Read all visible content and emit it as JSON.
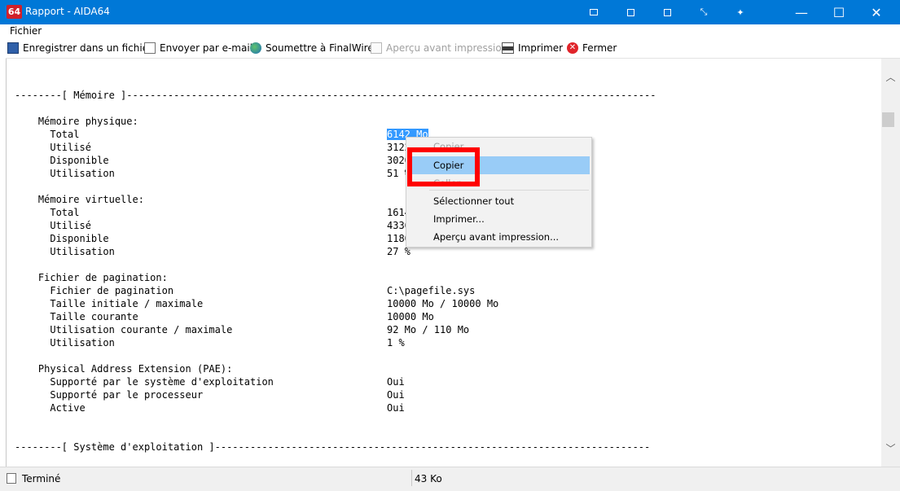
{
  "window": {
    "app_icon": "64",
    "title": "Rapport - AIDA64",
    "minimize": "—",
    "maximize": "☐",
    "close": "✕"
  },
  "menu": {
    "items": [
      "Fichier"
    ]
  },
  "toolbar": {
    "save": "Enregistrer dans un fichier",
    "email": "Envoyer par e-mail",
    "submit": "Soumettre à FinalWire",
    "preview": "Aperçu avant impression",
    "print": "Imprimer",
    "close": "Fermer"
  },
  "report": {
    "memory_header": "--------[ Mémoire ]------------------------------------------------------------------------------------------",
    "physical": {
      "title": "Mémoire physique:",
      "rows": [
        {
          "label": "Total",
          "value": "6142 Mo"
        },
        {
          "label": "Utilisé",
          "value": "3122"
        },
        {
          "label": "Disponible",
          "value": "3020"
        },
        {
          "label": "Utilisation",
          "value": "51 %"
        }
      ]
    },
    "virtual": {
      "title": "Mémoire virtuelle:",
      "rows": [
        {
          "label": "Total",
          "value": "1614"
        },
        {
          "label": "Utilisé",
          "value": "4336"
        },
        {
          "label": "Disponible",
          "value": "1180"
        },
        {
          "label": "Utilisation",
          "value": "27 %"
        }
      ]
    },
    "paging": {
      "title": "Fichier de pagination:",
      "rows": [
        {
          "label": "Fichier de pagination",
          "value": "C:\\pagefile.sys"
        },
        {
          "label": "Taille initiale / maximale",
          "value": "10000 Mo / 10000 Mo"
        },
        {
          "label": "Taille courante",
          "value": "10000 Mo"
        },
        {
          "label": "Utilisation courante / maximale",
          "value": "92 Mo / 110 Mo"
        },
        {
          "label": "Utilisation",
          "value": "1 %"
        }
      ]
    },
    "pae": {
      "title": "Physical Address Extension (PAE):",
      "rows": [
        {
          "label": "Supporté par le système d'exploitation",
          "value": "Oui"
        },
        {
          "label": "Supporté par le processeur",
          "value": "Oui"
        },
        {
          "label": "Active",
          "value": "Oui"
        }
      ]
    },
    "os_header": "--------[ Système d'exploitation ]--------------------------------------------------------------------------"
  },
  "context_menu": {
    "items": [
      {
        "label": "Copier",
        "state": "disabled"
      },
      {
        "label": "Copier",
        "state": "hover"
      },
      {
        "label": "Coller",
        "state": "disabled"
      },
      {
        "label": "Sélectionner tout",
        "state": "normal"
      },
      {
        "label": "Imprimer...",
        "state": "normal"
      },
      {
        "label": "Aperçu avant impression...",
        "state": "normal"
      }
    ]
  },
  "status": {
    "left": "Terminé",
    "size": "43 Ko"
  },
  "colors": {
    "titlebar": "#0078d7",
    "selection": "#3399ff",
    "highlight_box": "#ff0000",
    "menu_hover": "#99ccf7"
  },
  "icons": [
    "aida64-logo-icon",
    "save-icon",
    "document-icon",
    "globe-icon",
    "preview-icon",
    "printer-icon",
    "close-red-icon",
    "chevron-up-icon",
    "chevron-down-icon",
    "status-page-icon"
  ]
}
